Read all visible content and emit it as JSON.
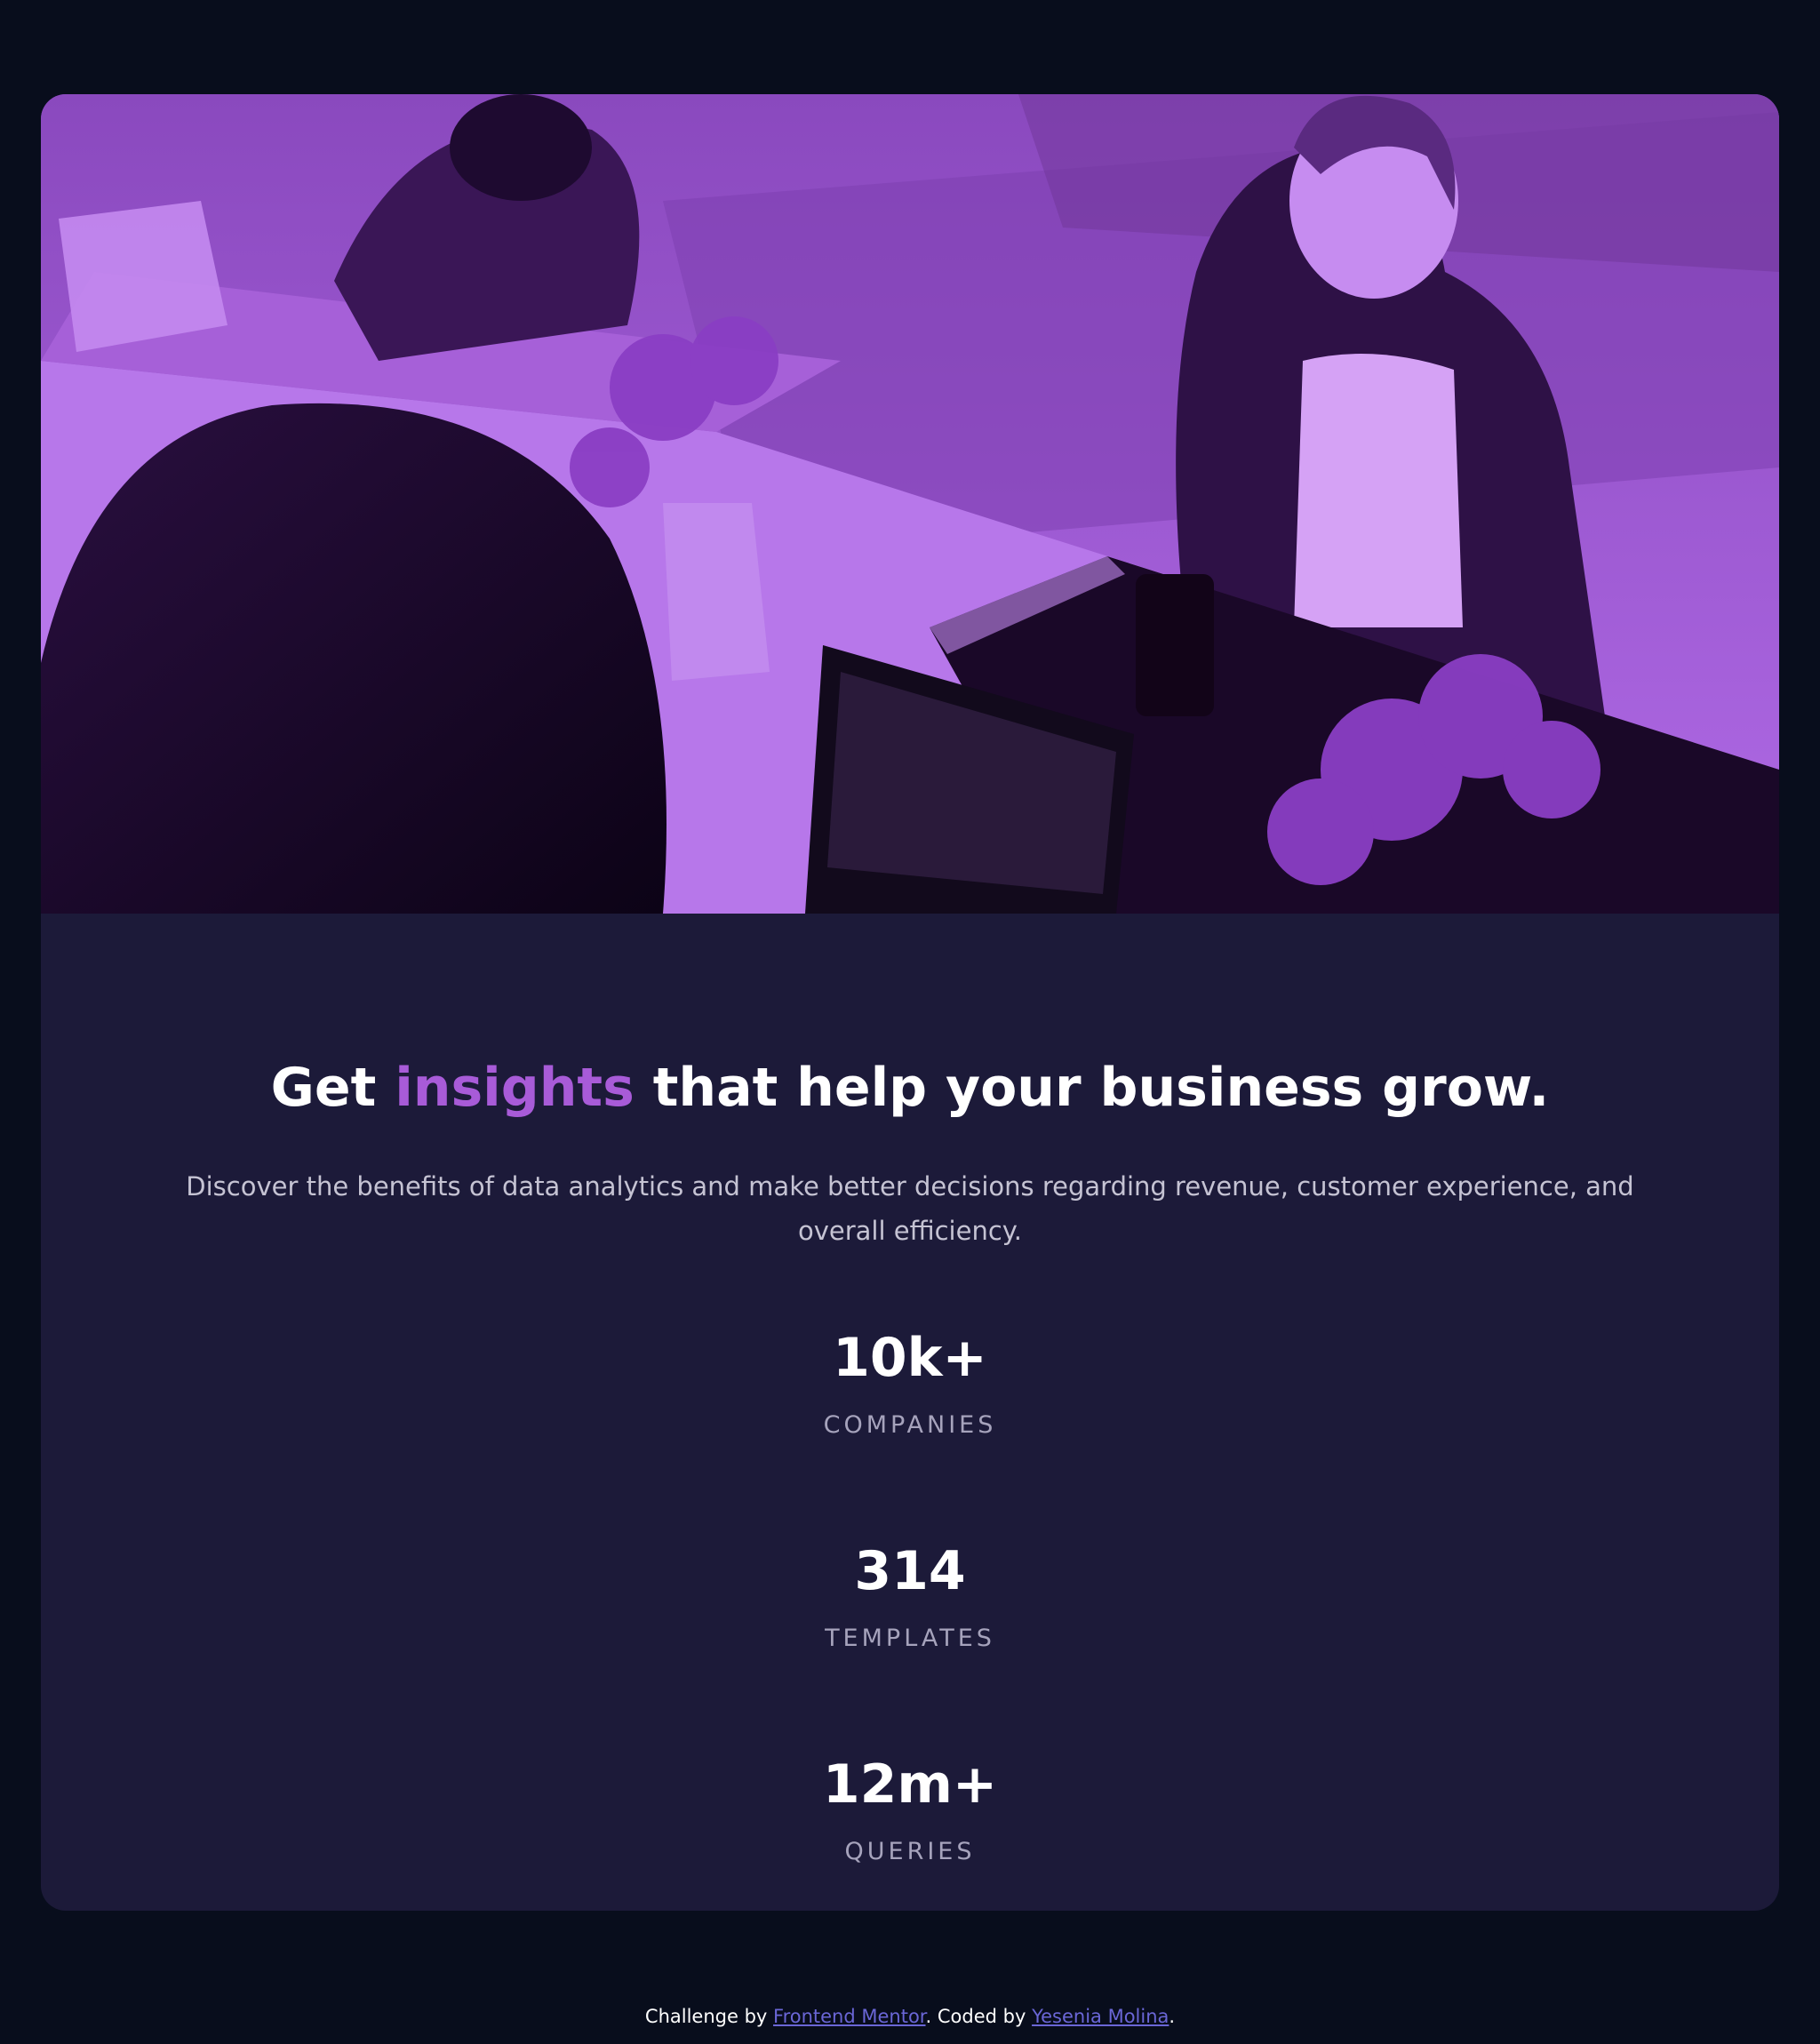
{
  "card": {
    "image_alt": "People working at a table with laptops",
    "heading": {
      "before": "Get ",
      "accent": "insights",
      "after": " that help your business grow."
    },
    "description": "Discover the benefits of data analytics and make better decisions regarding revenue, customer experience, and overall efficiency.",
    "stats": [
      {
        "value": "10k+",
        "label": "COMPANIES"
      },
      {
        "value": "314",
        "label": "TEMPLATES"
      },
      {
        "value": "12m+",
        "label": "QUERIES"
      }
    ]
  },
  "footer": {
    "prefix": "Challenge by ",
    "link1": "Frontend Mentor",
    "middle": ". Coded by ",
    "link2": "Yesenia Molina",
    "suffix": "."
  },
  "colors": {
    "page_background": "#080d1c",
    "card_background": "#1c1a39",
    "accent": "#a85bd8",
    "image_overlay": "#9b4fd6",
    "text_primary": "#ffffff",
    "text_muted": "#a6a3bc",
    "link": "#6a66d6"
  }
}
